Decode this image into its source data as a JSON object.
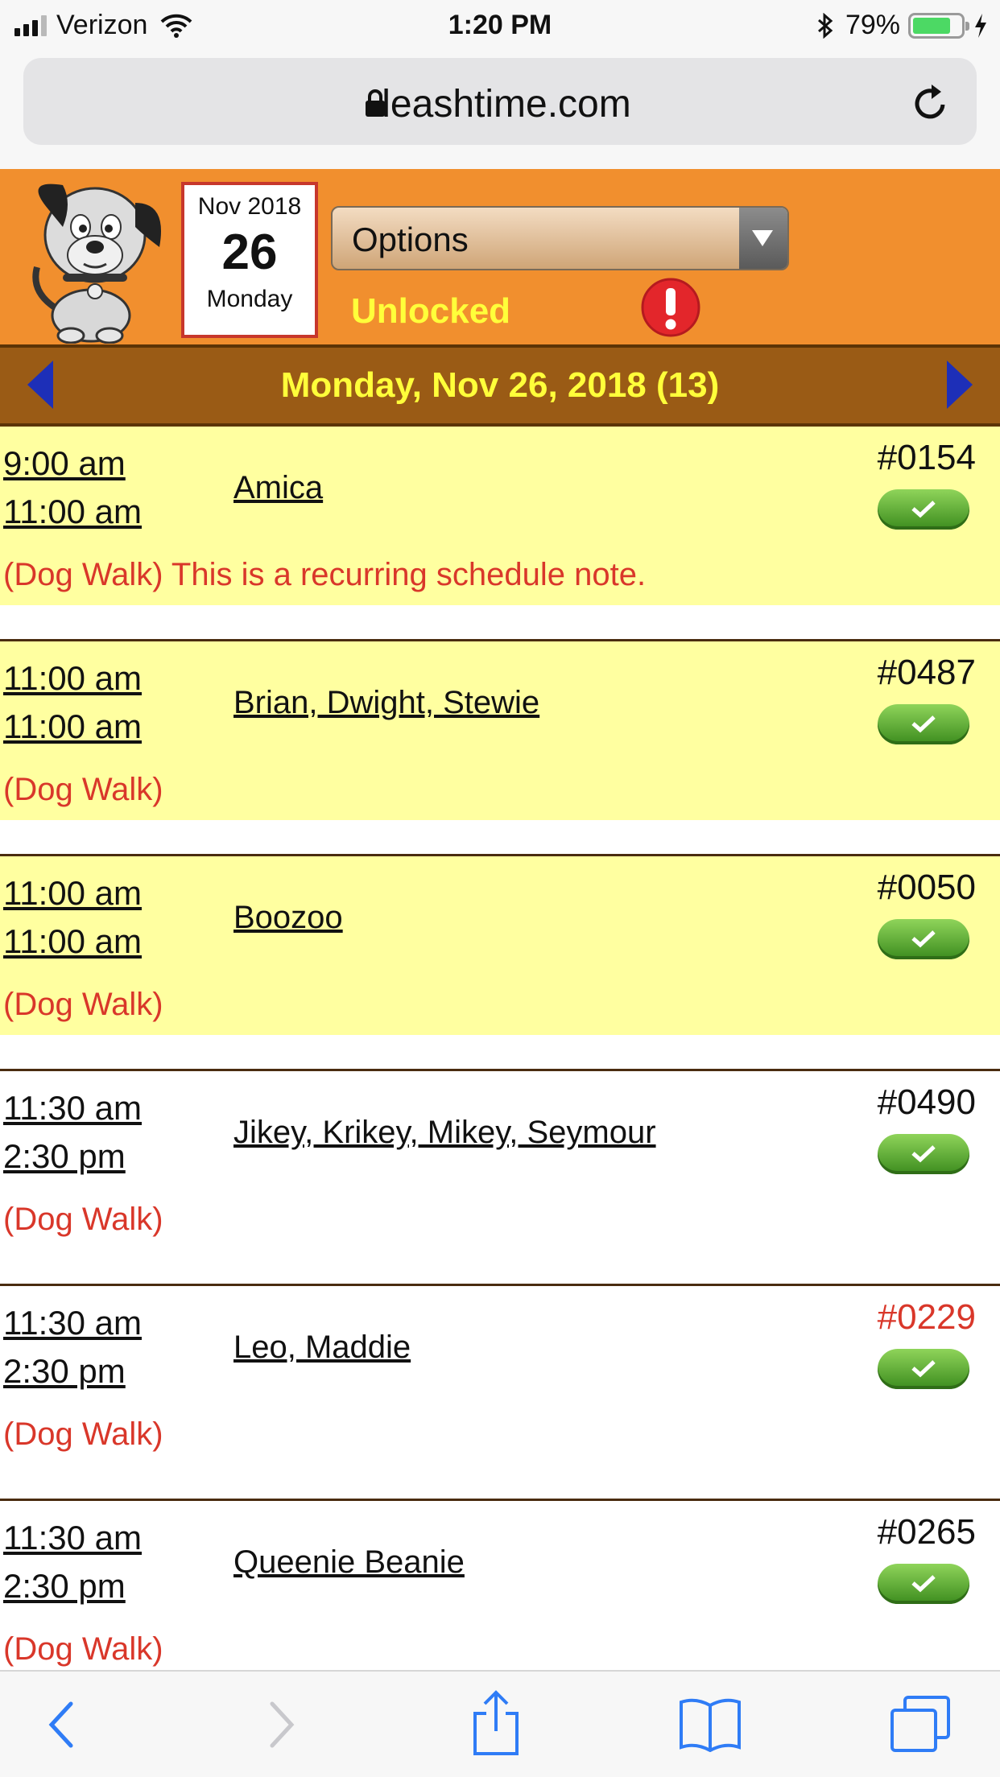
{
  "status_bar": {
    "carrier": "Verizon",
    "time": "1:20 PM",
    "battery_percent": "79%",
    "battery_level": 0.79
  },
  "browser": {
    "url": "leashtime.com"
  },
  "header": {
    "date_month": "Nov 2018",
    "date_day": "26",
    "date_weekday": "Monday",
    "options_label": "Options",
    "lock_status": "Unlocked"
  },
  "date_bar": {
    "title": "Monday, Nov 26, 2018 (13)"
  },
  "visits": [
    {
      "start": "9:00 am",
      "end": "11:00 am",
      "pets": "Amica",
      "number": "#0154",
      "note": "(Dog Walk) This is a recurring schedule note."
    },
    {
      "start": "11:00 am",
      "end": "11:00 am",
      "pets": "Brian, Dwight, Stewie",
      "number": "#0487",
      "note": "(Dog Walk)"
    },
    {
      "start": "11:00 am",
      "end": "11:00 am",
      "pets": "Boozoo",
      "number": "#0050",
      "note": "(Dog Walk)"
    },
    {
      "start": "11:30 am",
      "end": "2:30 pm",
      "pets": "Jikey, Krikey, Mikey, Seymour",
      "number": "#0490",
      "note": "(Dog Walk)"
    },
    {
      "start": "11:30 am",
      "end": "2:30 pm",
      "pets": "Leo, Maddie",
      "number": "#0229",
      "note": "(Dog Walk)"
    },
    {
      "start": "11:30 am",
      "end": "2:30 pm",
      "pets": "Queenie Beanie",
      "number": "#0265",
      "note": "(Dog Walk)"
    }
  ],
  "colors": {
    "header_orange": "#f18f2e",
    "date_bar_brown": "#9a5b15",
    "highlight_yellow": "#ffffa0",
    "note_red": "#d9372a",
    "unlocked_yellow": "#ffff3a"
  },
  "icons": {
    "logo": "dog-mascot-icon",
    "alert": "exclamation-alert-icon",
    "prev": "left-triangle-icon",
    "next": "right-triangle-icon",
    "complete": "checkmark-icon",
    "toolbar": [
      "back-icon",
      "forward-icon",
      "share-icon",
      "bookmarks-icon",
      "tabs-icon"
    ]
  }
}
